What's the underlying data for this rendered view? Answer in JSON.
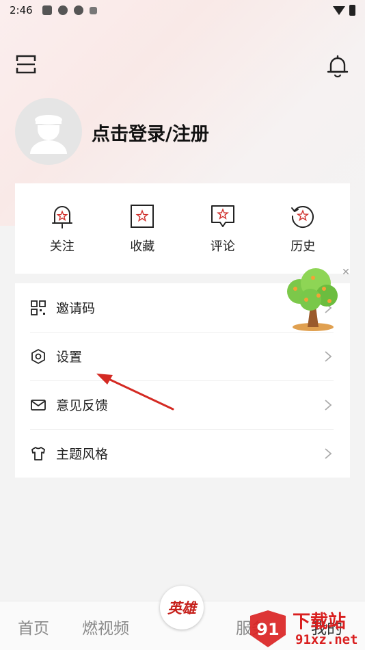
{
  "status_bar": {
    "time": "2:46",
    "icons": [
      "app-icon",
      "app-icon",
      "app-icon",
      "a-icon"
    ],
    "right_icons": [
      "wifi-icon",
      "battery-icon"
    ]
  },
  "header": {
    "scan_icon": "scan-icon",
    "bell_icon": "bell-icon"
  },
  "profile": {
    "login_text": "点击登录/注册"
  },
  "quick_actions": [
    {
      "label": "关注",
      "icon": "follow-bell-icon"
    },
    {
      "label": "收藏",
      "icon": "collect-star-icon"
    },
    {
      "label": "评论",
      "icon": "comment-icon"
    },
    {
      "label": "历史",
      "icon": "history-icon"
    }
  ],
  "menu": [
    {
      "label": "邀请码",
      "icon": "qrcode-icon"
    },
    {
      "label": "设置",
      "icon": "settings-icon"
    },
    {
      "label": "意见反馈",
      "icon": "mail-icon"
    },
    {
      "label": "主题风格",
      "icon": "shirt-icon"
    }
  ],
  "tabbar": {
    "home": "首页",
    "video": "燃视频",
    "center": "英雄",
    "service": "服务",
    "mine": "我的"
  },
  "watermark": {
    "title": "下载站",
    "site": "91xz.net",
    "badge": "91"
  },
  "colors": {
    "accent": "#d0312d",
    "arrow": "#d42a23"
  }
}
